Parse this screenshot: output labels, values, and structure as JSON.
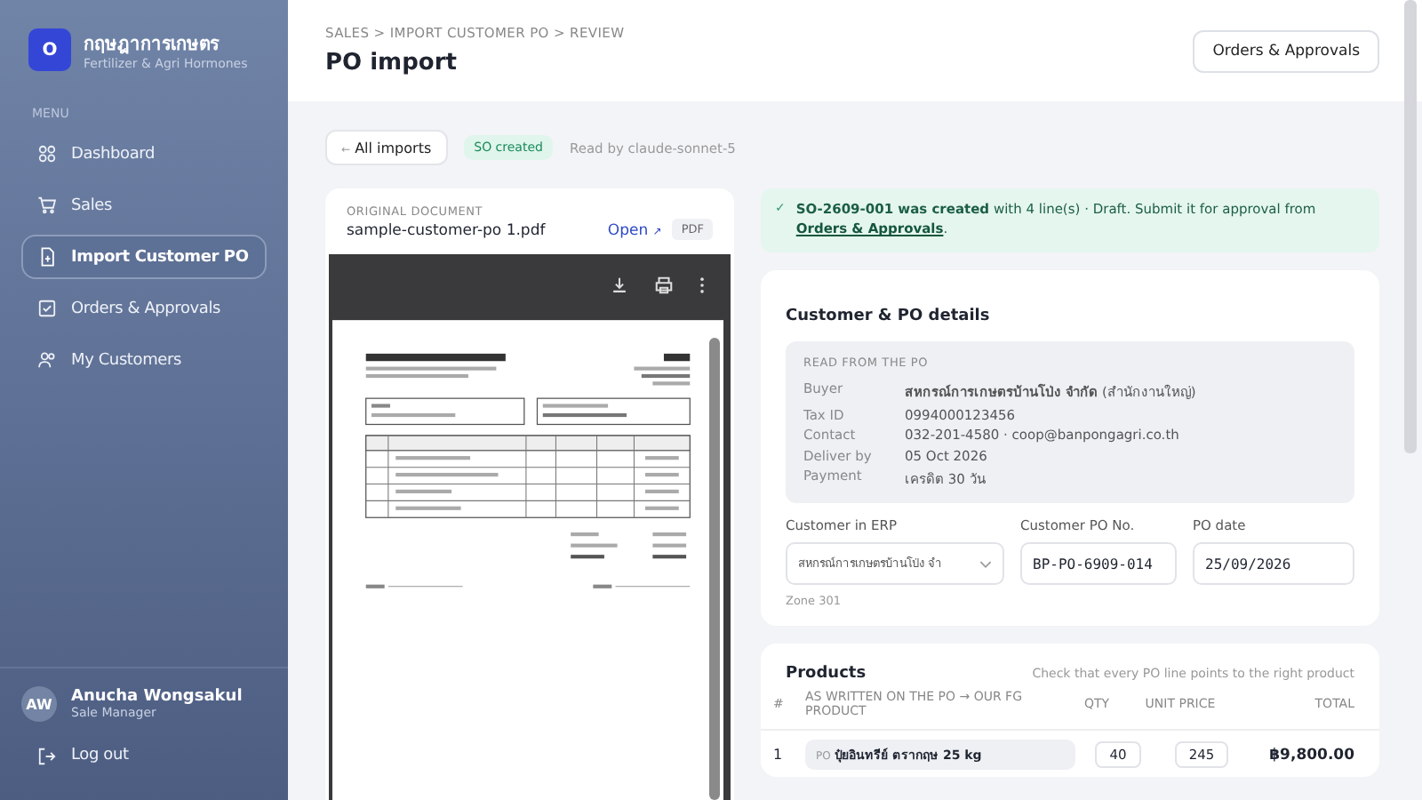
{
  "brand": {
    "logo_letter": "O",
    "name": "กฤษฎาการเกษตร",
    "subtitle": "Fertilizer & Agri Hormones"
  },
  "menu_label": "MENU",
  "nav": [
    {
      "label": "Dashboard",
      "selected": false
    },
    {
      "label": "Sales",
      "selected": false
    },
    {
      "label": "Import Customer PO",
      "selected": true
    },
    {
      "label": "Orders & Approvals",
      "selected": false
    },
    {
      "label": "My Customers",
      "selected": false
    }
  ],
  "user": {
    "initials": "AW",
    "name": "Anucha Wongsakul",
    "role": "Sale Manager",
    "logout": "Log out"
  },
  "breadcrumb": "SALES > IMPORT CUSTOMER PO > REVIEW",
  "title": "PO import",
  "header_button": "Orders & Approvals",
  "toolbar": {
    "back": "All imports",
    "back_icon": "←",
    "status": "SO created",
    "read_by": "Read by claude-sonnet-5"
  },
  "document": {
    "label": "ORIGINAL DOCUMENT",
    "filename": "sample-customer-po 1.pdf",
    "open": "Open",
    "open_icon": "↗",
    "type": "PDF"
  },
  "notice": {
    "icon": "✓",
    "text": "**SO-2609-001 was created** with 4 line(s) · Draft. Submit it for approval from ",
    "link": "Orders & Approvals",
    "end": "."
  },
  "details": {
    "title": "Customer & PO details",
    "read_label": "READ FROM THE PO",
    "rows": [
      {
        "label": "Buyer",
        "value": "**สหกรณ์การเกษตรบ้านโป่ง จำกัด** (สำนักงานใหญ่)"
      },
      {
        "label": "Tax ID",
        "value": "0994000123456"
      },
      {
        "label": "Contact",
        "value": "032-201-4580 · coop@banpongagri.co.th"
      },
      {
        "label": "Deliver by",
        "value": "05 Oct 2026"
      },
      {
        "label": "Payment",
        "value": "เครดิต 30 วัน"
      }
    ],
    "fields": [
      {
        "label": "Customer in ERP",
        "value": "สหกรณ์การเกษตรบ้านโป่ง จำ",
        "kind": "select"
      },
      {
        "label": "Customer PO No.",
        "value": "BP-PO-6909-014",
        "kind": "input"
      },
      {
        "label": "PO date",
        "value": "25/09/2026",
        "kind": "input"
      }
    ],
    "zone": "Zone 301"
  },
  "products": {
    "title": "Products",
    "hint": "Check that every PO line points to the right product",
    "columns": [
      "#",
      "AS WRITTEN ON THE PO → OUR FG PRODUCT",
      "QTY",
      "UNIT PRICE",
      "TOTAL"
    ],
    "rows": [
      {
        "index": "1",
        "tag": "PO",
        "name": "ปุ๋ยอินทรีย์ ตรากฤษ 25 kg",
        "qty": "40",
        "price": "245",
        "total": "฿9,800.00"
      }
    ]
  }
}
